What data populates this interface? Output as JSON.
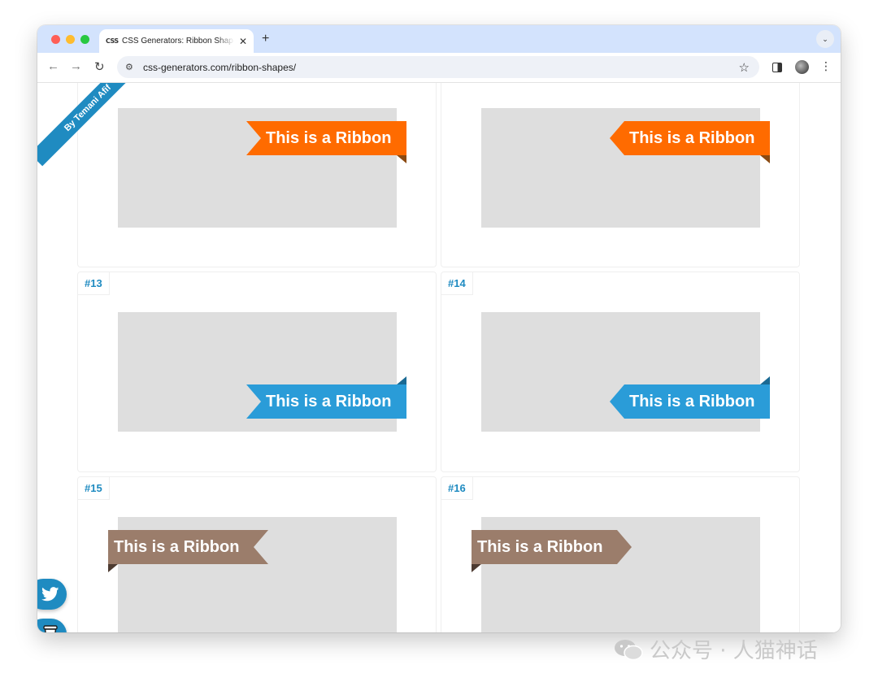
{
  "browser": {
    "tab": {
      "favicon_text": "CSS",
      "title": "CSS Generators: Ribbon Shapes",
      "close_glyph": "✕"
    },
    "new_tab_glyph": "+",
    "tab_menu_glyph": "⌄",
    "url": "css-generators.com/ribbon-shapes/",
    "icons": {
      "back": "arrow-left",
      "forward": "arrow-right",
      "reload": "reload",
      "site_info": "tune",
      "bookmark": "star",
      "side_panel": "side-panel",
      "profile": "avatar",
      "menu": "kebab"
    }
  },
  "page": {
    "byline": "By Temani Afif",
    "byline_color": "#1f8bc1",
    "ribbon_text": "This is a Ribbon",
    "cards": [
      {
        "label": "",
        "color": "#ff6b00",
        "dark": "#8b4a12",
        "style": "notch-left-fold-bottom-right"
      },
      {
        "label": "",
        "color": "#ff6b00",
        "dark": "#8b4a12",
        "style": "point-left-fold-bottom-right"
      },
      {
        "label": "#13",
        "color": "#2a9cd8",
        "dark": "#1a6a94",
        "style": "notch-left-fold-top-right"
      },
      {
        "label": "#14",
        "color": "#2a9cd8",
        "dark": "#1a6a94",
        "style": "point-left-fold-top-right"
      },
      {
        "label": "#15",
        "color": "#9b7d6b",
        "dark": "#4d3b31",
        "style": "notch-right-fold-bottom-left"
      },
      {
        "label": "#16",
        "color": "#9b7d6b",
        "dark": "#4d3b31",
        "style": "point-right-fold-bottom-left"
      }
    ],
    "share_buttons": [
      {
        "name": "twitter",
        "icon": "twitter-bird",
        "color": "#1f8bc1"
      },
      {
        "name": "buy-me-a-coffee",
        "icon": "coffee-cup",
        "color": "#1f8bc1"
      }
    ]
  },
  "watermark": "公众号 · 人猫神话"
}
